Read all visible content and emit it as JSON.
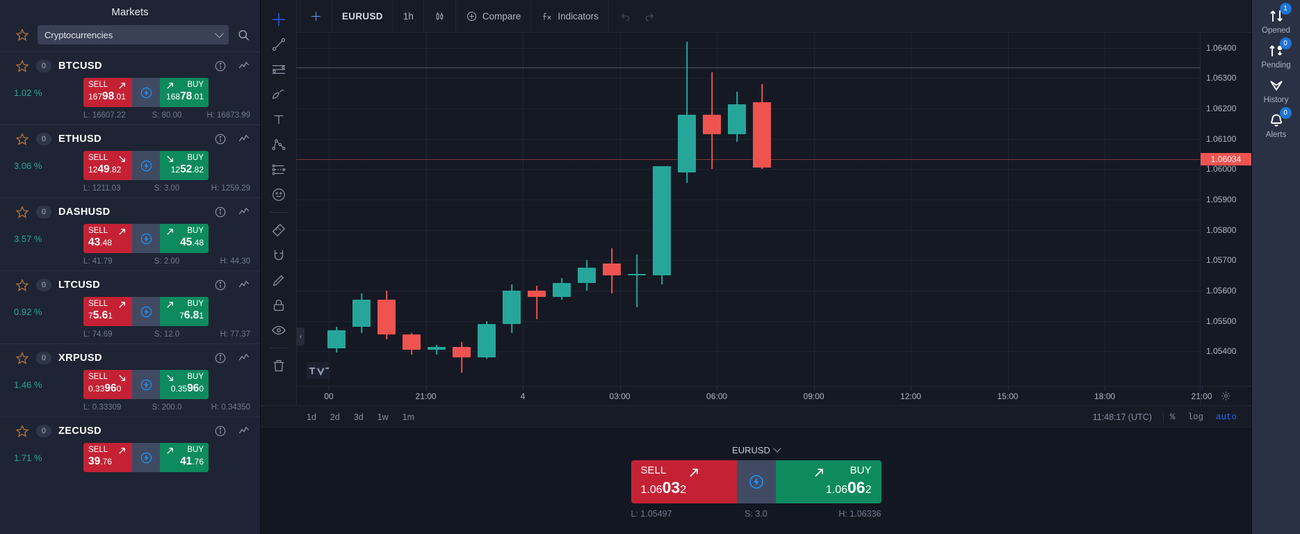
{
  "sidebar": {
    "title": "Markets",
    "filter": {
      "value": "Cryptocurrencies",
      "icon": "chevron-down-icon"
    },
    "search_icon": "search-icon",
    "favorite_icon": "star-icon",
    "instruments": [
      {
        "symbol": "BTCUSD",
        "leverage": "0",
        "change": "1.02 %",
        "sell_label": "SELL",
        "sell_big": "16798",
        "sell_main": "98",
        "sell_pre": "167",
        "sell_post": ".01",
        "sell_trend": "up",
        "buy_label": "BUY",
        "buy_pre": "168",
        "buy_main": "78",
        "buy_post": ".01",
        "buy_trend": "up",
        "low": "L: 16607.22",
        "spread": "S: 80.00",
        "high": "H: 16873.99"
      },
      {
        "symbol": "ETHUSD",
        "leverage": "0",
        "change": "3.06 %",
        "sell_label": "SELL",
        "sell_pre": "12",
        "sell_main": "49",
        "sell_post": ".82",
        "sell_trend": "down",
        "buy_label": "BUY",
        "buy_pre": "12",
        "buy_main": "52",
        "buy_post": ".82",
        "buy_trend": "down",
        "low": "L: 1211.03",
        "spread": "S: 3.00",
        "high": "H: 1259.29"
      },
      {
        "symbol": "DASHUSD",
        "leverage": "0",
        "change": "3.57 %",
        "sell_label": "SELL",
        "sell_pre": "",
        "sell_main": "43",
        "sell_post": ".48",
        "sell_trend": "up",
        "buy_label": "BUY",
        "buy_pre": "",
        "buy_main": "45",
        "buy_post": ".48",
        "buy_trend": "up",
        "low": "L: 41.79",
        "spread": "S: 2.00",
        "high": "H: 44.30"
      },
      {
        "symbol": "LTCUSD",
        "leverage": "0",
        "change": "0.92 %",
        "sell_label": "SELL",
        "sell_pre": "7",
        "sell_main": "5.6",
        "sell_post": "1",
        "sell_trend": "up",
        "buy_label": "BUY",
        "buy_pre": "7",
        "buy_main": "6.8",
        "buy_post": "1",
        "buy_trend": "up",
        "low": "L: 74.69",
        "spread": "S: 12.0",
        "high": "H: 77.37"
      },
      {
        "symbol": "XRPUSD",
        "leverage": "0",
        "change": "1.46 %",
        "sell_label": "SELL",
        "sell_pre": "0.33",
        "sell_main": "96",
        "sell_post": "0",
        "sell_trend": "down",
        "buy_label": "BUY",
        "buy_pre": "0.35",
        "buy_main": "96",
        "buy_post": "0",
        "buy_trend": "down",
        "low": "L: 0.33309",
        "spread": "S: 200.0",
        "high": "H: 0.34350"
      },
      {
        "symbol": "ZECUSD",
        "leverage": "0",
        "change": "1.71 %",
        "sell_label": "SELL",
        "sell_pre": "",
        "sell_main": "39",
        "sell_post": ".76",
        "sell_trend": "up",
        "buy_label": "BUY",
        "buy_pre": "",
        "buy_main": "41",
        "buy_post": ".76",
        "buy_trend": "up",
        "low": "",
        "spread": "",
        "high": ""
      }
    ]
  },
  "chart": {
    "toolbar": {
      "crosshair_icon": "crosshair-icon",
      "symbol": "EURUSD",
      "interval": "1h",
      "chart_type_icon": "candlestick-icon",
      "compare_label": "Compare",
      "compare_icon": "plus-circle-icon",
      "indicators_label": "Indicators",
      "indicators_icon": "fx-icon",
      "undo_icon": "undo-icon",
      "redo_icon": "redo-icon"
    },
    "drawing_tools": [
      "crosshair-tool-icon",
      "trend-line-icon",
      "horizontal-rays-icon",
      "brush-icon",
      "text-tool-icon",
      "pattern-icon",
      "forecast-icon",
      "emoji-icon",
      "measure-icon",
      "magnet-icon",
      "ruler-icon",
      "pencil-icon",
      "lock-icon",
      "eye-icon",
      "trash-icon"
    ],
    "footer": {
      "timeframes": [
        "1d",
        "2d",
        "3d",
        "1w",
        "1m"
      ],
      "clock": "11:48:17 (UTC)",
      "percent_label": "%",
      "log_label": "log",
      "auto_label": "auto",
      "gear_icon": "gear-icon",
      "tv_logo": "tradingview-logo-icon"
    },
    "chart_data": {
      "type": "candlestick",
      "title": "EURUSD 1h",
      "xlabel": "",
      "ylabel": "",
      "ylim": [
        1.0535,
        1.0645
      ],
      "grid": true,
      "legend": "none",
      "price_ticks": [
        "1.06400",
        "1.06300",
        "1.06200",
        "1.06100",
        "1.06000",
        "1.05900",
        "1.05800",
        "1.05700",
        "1.05600",
        "1.05500",
        "1.05400"
      ],
      "time_ticks": [
        "00",
        "21:00",
        "4",
        "03:00",
        "06:00",
        "09:00",
        "12:00",
        "15:00",
        "18:00",
        "21:00"
      ],
      "current_price": "1.06034",
      "current_price_color": "#ef5350",
      "up_color": "#26a69a",
      "down_color": "#ef5350",
      "high_marker": "1.06336",
      "candles": [
        {
          "o": 1.0547,
          "h": 1.0548,
          "l": 1.05395,
          "c": 1.0541,
          "dir": "up"
        },
        {
          "o": 1.0548,
          "h": 1.0559,
          "l": 1.0546,
          "c": 1.0557,
          "dir": "up"
        },
        {
          "o": 1.0557,
          "h": 1.056,
          "l": 1.0544,
          "c": 1.05455,
          "dir": "down"
        },
        {
          "o": 1.05455,
          "h": 1.0546,
          "l": 1.0539,
          "c": 1.05405,
          "dir": "down"
        },
        {
          "o": 1.05405,
          "h": 1.0542,
          "l": 1.0539,
          "c": 1.05415,
          "dir": "up"
        },
        {
          "o": 1.05415,
          "h": 1.0543,
          "l": 1.0533,
          "c": 1.0538,
          "dir": "down"
        },
        {
          "o": 1.0538,
          "h": 1.055,
          "l": 1.05375,
          "c": 1.0549,
          "dir": "up"
        },
        {
          "o": 1.0549,
          "h": 1.0562,
          "l": 1.0546,
          "c": 1.056,
          "dir": "up"
        },
        {
          "o": 1.056,
          "h": 1.05615,
          "l": 1.05505,
          "c": 1.0558,
          "dir": "down"
        },
        {
          "o": 1.0558,
          "h": 1.0564,
          "l": 1.0557,
          "c": 1.05625,
          "dir": "up"
        },
        {
          "o": 1.05625,
          "h": 1.057,
          "l": 1.056,
          "c": 1.05675,
          "dir": "up"
        },
        {
          "o": 1.0569,
          "h": 1.0574,
          "l": 1.0559,
          "c": 1.0565,
          "dir": "down"
        },
        {
          "o": 1.05655,
          "h": 1.0572,
          "l": 1.05545,
          "c": 1.0565,
          "dir": "up"
        },
        {
          "o": 1.0565,
          "h": 1.0601,
          "l": 1.0562,
          "c": 1.0601,
          "dir": "up"
        },
        {
          "o": 1.0599,
          "h": 1.0642,
          "l": 1.05955,
          "c": 1.0618,
          "dir": "up"
        },
        {
          "o": 1.0618,
          "h": 1.0632,
          "l": 1.06,
          "c": 1.06115,
          "dir": "down"
        },
        {
          "o": 1.06115,
          "h": 1.06255,
          "l": 1.0609,
          "c": 1.06215,
          "dir": "up"
        },
        {
          "o": 1.0622,
          "h": 1.0628,
          "l": 1.06,
          "c": 1.06005,
          "dir": "down"
        }
      ]
    }
  },
  "deal_panel": {
    "symbol": "EURUSD",
    "chevron_icon": "chevron-down-icon",
    "sell_label": "SELL",
    "sell_pre": "1.06",
    "sell_main": "03",
    "sell_post": "2",
    "buy_label": "BUY",
    "buy_pre": "1.06",
    "buy_main": "06",
    "buy_post": "2",
    "bolt_icon": "bolt-icon",
    "low": "L: 1.05497",
    "spread": "S: 3.0",
    "high": "H: 1.06336"
  },
  "rail": {
    "items": [
      {
        "label": "Opened",
        "badge": "1",
        "icon": "opened-orders-icon"
      },
      {
        "label": "Pending",
        "badge": "0",
        "icon": "pending-orders-icon"
      },
      {
        "label": "History",
        "badge": "",
        "icon": "history-icon"
      },
      {
        "label": "Alerts",
        "badge": "0",
        "icon": "alerts-bell-icon"
      }
    ]
  }
}
